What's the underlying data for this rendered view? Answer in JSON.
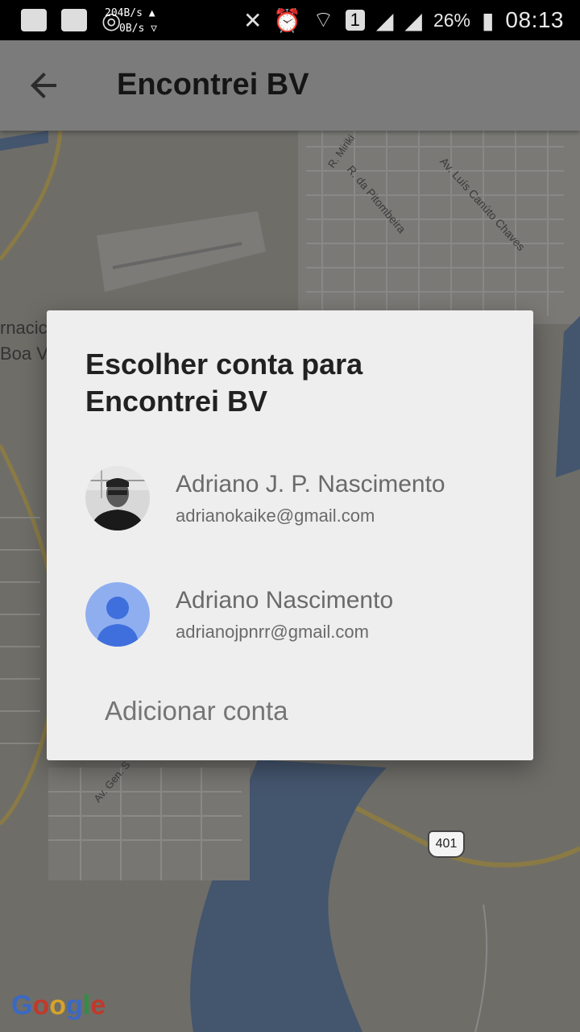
{
  "status_bar": {
    "speed_up": "204B/s ▲",
    "speed_down": "0B/s ▽",
    "battery": "26%",
    "time": "08:13",
    "sim_slot": "1"
  },
  "app_bar": {
    "title": "Encontrei BV",
    "back_icon": "arrow-back-icon"
  },
  "map": {
    "labels": {
      "r_mirik": "R. Miriki",
      "r_pitombeira": "R. da Pitombeira",
      "av_luis": "Av. Luís Canúto Chaves",
      "av_gen": "Av. Gen. S",
      "left_top": "rnacic",
      "left_bottom": "Boa V"
    },
    "route_shield": "401",
    "google_logo": "Google"
  },
  "dialog": {
    "title": "Escolher conta para Encontrei BV",
    "accounts": [
      {
        "name": "Adriano J. P. Nascimento",
        "email": "adrianokaike@gmail.com",
        "avatar": "photo-avatar"
      },
      {
        "name": "Adriano Nascimento",
        "email": "adrianojpnrr@gmail.com",
        "avatar": "default-person-icon"
      }
    ],
    "add_account": "Adicionar conta"
  }
}
